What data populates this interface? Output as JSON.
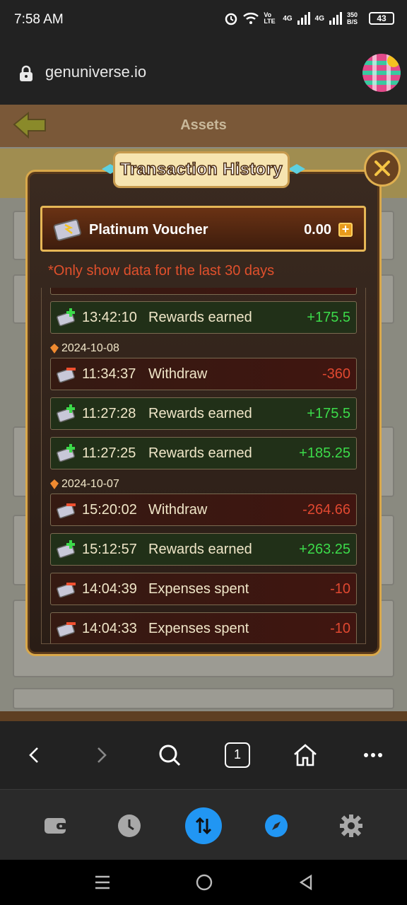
{
  "status_bar": {
    "time": "7:58 AM",
    "net_labels": [
      "Vo LTE",
      "4G",
      "4G"
    ],
    "speed": "350 B/S",
    "battery": "43"
  },
  "browser": {
    "url": "genuniverse.io"
  },
  "game": {
    "page_title": "Assets"
  },
  "modal": {
    "title": "Transaction History",
    "voucher": {
      "name": "Platinum Voucher",
      "amount": "0.00"
    },
    "note": "*Only show data for the last 30 days",
    "entries": [
      {
        "kind": "earn",
        "time": "13:42:10",
        "desc": "Rewards earned",
        "amount": "+175.5"
      },
      {
        "kind": "date",
        "label": "2024-10-08"
      },
      {
        "kind": "spend",
        "time": "11:34:37",
        "desc": "Withdraw",
        "amount": "-360"
      },
      {
        "kind": "earn",
        "time": "11:27:28",
        "desc": "Rewards earned",
        "amount": "+175.5"
      },
      {
        "kind": "earn",
        "time": "11:27:25",
        "desc": "Rewards earned",
        "amount": "+185.25"
      },
      {
        "kind": "date",
        "label": "2024-10-07"
      },
      {
        "kind": "spend",
        "time": "15:20:02",
        "desc": "Withdraw",
        "amount": "-264.66"
      },
      {
        "kind": "earn",
        "time": "15:12:57",
        "desc": "Rewards earned",
        "amount": "+263.25"
      },
      {
        "kind": "spend",
        "time": "14:04:39",
        "desc": "Expenses spent",
        "amount": "-10"
      },
      {
        "kind": "spend",
        "time": "14:04:33",
        "desc": "Expenses spent",
        "amount": "-10"
      }
    ]
  },
  "browser_nav": {
    "tab_count": "1"
  },
  "colors": {
    "earn": "#3cdb4a",
    "spend": "#e04830",
    "note": "#e0502c",
    "accent": "#2196f3"
  },
  "icons": {
    "app_bar": [
      "wallet-icon",
      "history-icon",
      "swap-icon",
      "explore-icon",
      "settings-icon"
    ],
    "browser_nav": [
      "back-icon",
      "forward-icon",
      "search-icon",
      "tabs-icon",
      "home-icon",
      "more-icon"
    ],
    "system_nav": [
      "recents-icon",
      "home-circle-icon",
      "back-triangle-icon"
    ]
  }
}
